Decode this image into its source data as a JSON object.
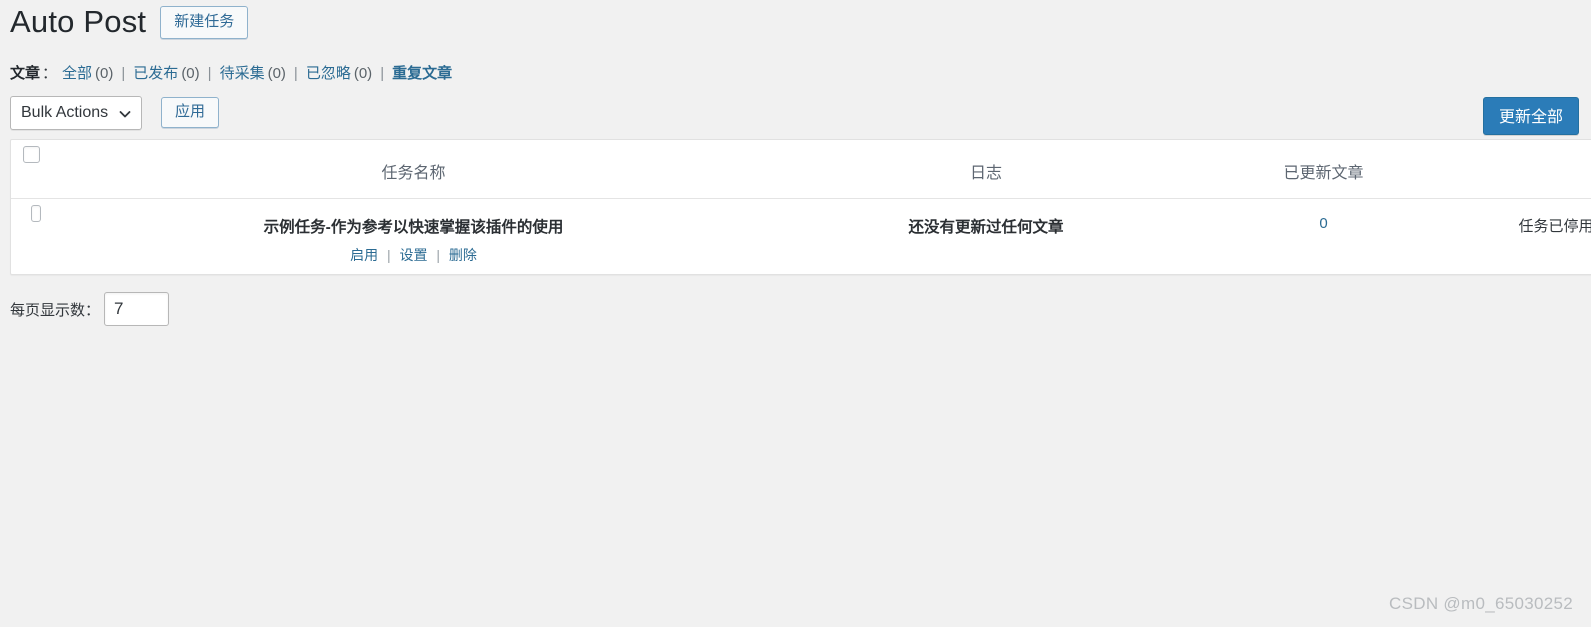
{
  "header": {
    "title": "Auto Post",
    "new_task_label": "新建任务"
  },
  "filters": {
    "label": "文章",
    "colon": "：",
    "separator": "|",
    "items": [
      {
        "label": "全部",
        "count": "(0)"
      },
      {
        "label": "已发布",
        "count": "(0)"
      },
      {
        "label": "待采集",
        "count": "(0)"
      },
      {
        "label": "已忽略",
        "count": "(0)"
      },
      {
        "label": "重复文章",
        "count": ""
      }
    ]
  },
  "tablenav": {
    "bulk_actions_value": "Bulk Actions",
    "bulk_actions_icon": "chevron-down-icon",
    "apply_label": "应用",
    "update_all_label": "更新全部"
  },
  "table": {
    "columns": [
      {
        "key": "cb",
        "label": ""
      },
      {
        "key": "name",
        "label": "任务名称"
      },
      {
        "key": "log",
        "label": "日志"
      },
      {
        "key": "updated",
        "label": "已更新文章"
      },
      {
        "key": "status",
        "label": ""
      }
    ],
    "rows": [
      {
        "name": "示例任务-作为参考以快速掌握该插件的使用",
        "actions": [
          {
            "label": "启用"
          },
          {
            "label": "设置"
          },
          {
            "label": "删除"
          }
        ],
        "action_separator": "|",
        "log": "还没有更新过任何文章",
        "updated": "0",
        "status": "任务已停用"
      }
    ]
  },
  "per_page": {
    "label": "每页显示数：",
    "value": "7"
  },
  "watermark": "CSDN @m0_65030252",
  "colors": {
    "page_bg": "#f1f1f1",
    "link_blue": "#2b6b93",
    "primary_button": "#2b7cb8",
    "title_text": "#23282d",
    "table_bg": "#ffffff"
  }
}
